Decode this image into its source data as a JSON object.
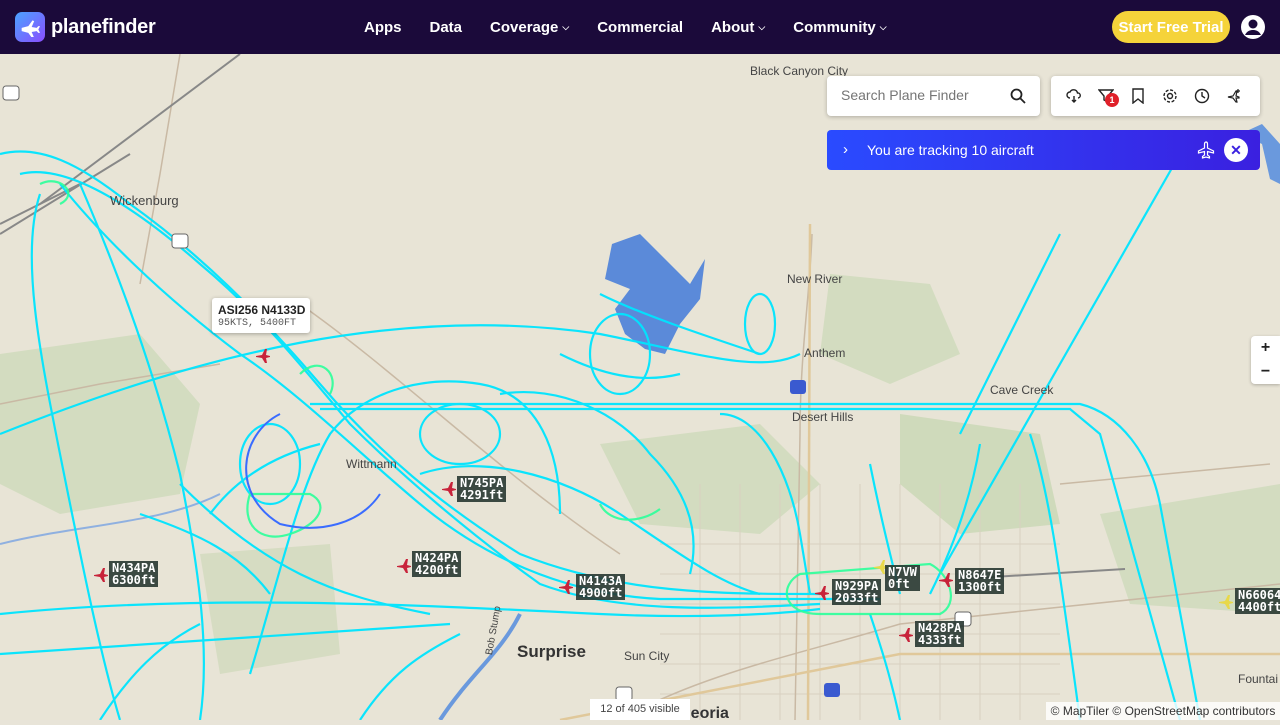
{
  "nav": {
    "brand": "planefinder",
    "links": [
      {
        "label": "Apps",
        "dropdown": false
      },
      {
        "label": "Data",
        "dropdown": false
      },
      {
        "label": "Coverage",
        "dropdown": true
      },
      {
        "label": "Commercial",
        "dropdown": false
      },
      {
        "label": "About",
        "dropdown": true
      },
      {
        "label": "Community",
        "dropdown": true
      }
    ],
    "trial_label": "Start Free Trial"
  },
  "search": {
    "placeholder": "Search Plane Finder"
  },
  "toolbar": {
    "filter_count": "1",
    "icons": [
      "weather-icon",
      "filter-icon",
      "bookmark-icon",
      "settings-icon",
      "history-icon",
      "plane-add-icon"
    ]
  },
  "tracking": {
    "text": "You are tracking 10 aircraft"
  },
  "zoom": {
    "in": "+",
    "out": "−"
  },
  "popup": {
    "title": "ASI256 N4133D",
    "sub": "95KTS, 5400FT"
  },
  "map_labels": {
    "black_canyon": "Black Canyon City",
    "wickenburg": "Wickenburg",
    "new_river": "New River",
    "anthem": "Anthem",
    "cave_creek": "Cave Creek",
    "desert_hills": "Desert Hills",
    "wittmann": "Wittmann",
    "surprise": "Surprise",
    "sun_city": "Sun City",
    "peoria": "Peoria",
    "fountain": "Fountai",
    "bob_stump": "Bob Stump"
  },
  "aircraft": [
    {
      "callsign": "N745PA",
      "alt": "4291ft"
    },
    {
      "callsign": "N424PA",
      "alt": "4200ft"
    },
    {
      "callsign": "N434PA",
      "alt": "6300ft"
    },
    {
      "callsign": "N4143A",
      "alt": "4900ft"
    },
    {
      "callsign": "N929PA",
      "alt": "2033ft"
    },
    {
      "callsign": "N7VW",
      "alt": "0ft"
    },
    {
      "callsign": "N8647E",
      "alt": "1300ft"
    },
    {
      "callsign": "N428PA",
      "alt": "4333ft"
    },
    {
      "callsign": "N66064",
      "alt": "4400ft"
    }
  ],
  "footer": {
    "count": "12 of 405 visible",
    "attribution": "© MapTiler © OpenStreetMap contributors"
  },
  "colors": {
    "nav_bg": "#1b0a3a",
    "track_line": "#00e5ff",
    "trial": "#f5d33a",
    "aircraft": "#c8233a"
  }
}
